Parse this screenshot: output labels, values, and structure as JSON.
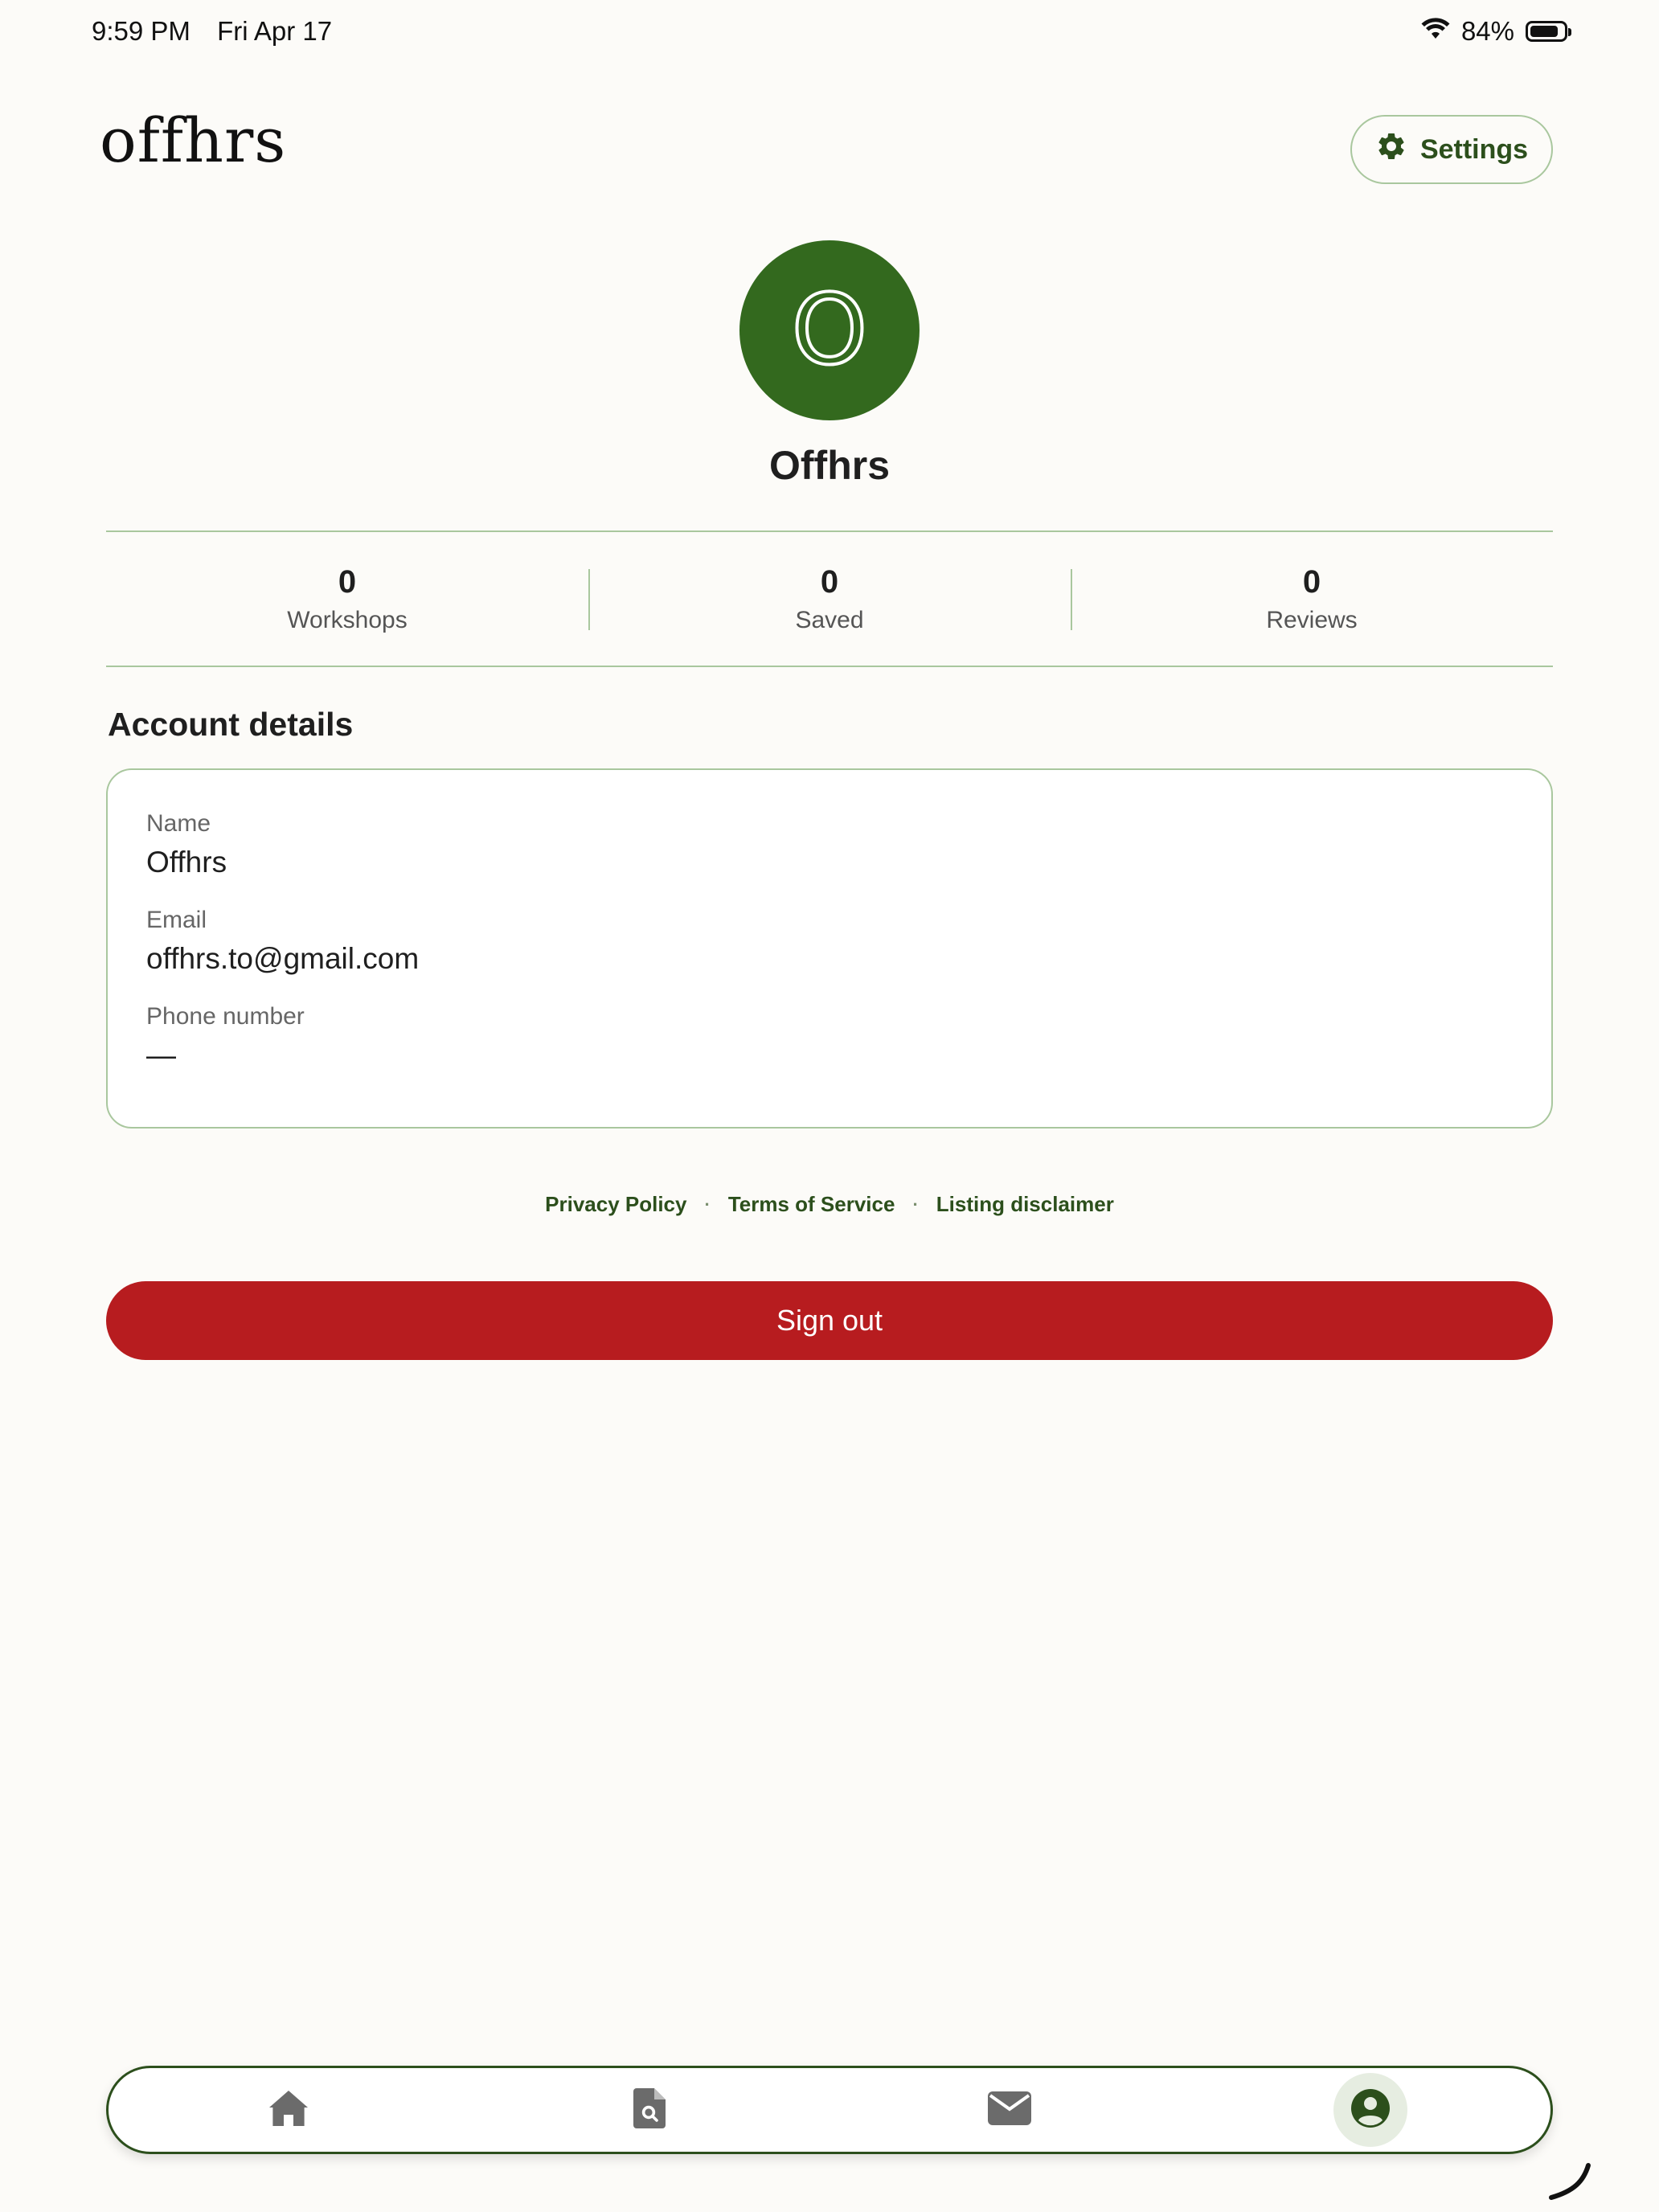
{
  "status_bar": {
    "time": "9:59 PM",
    "date": "Fri Apr 17",
    "battery": "84%",
    "battery_level": 0.84
  },
  "header": {
    "logo": "offhrs",
    "settings_label": "Settings"
  },
  "profile": {
    "initial": "O",
    "name": "Offhrs"
  },
  "stats": [
    {
      "value": "0",
      "label": "Workshops"
    },
    {
      "value": "0",
      "label": "Saved"
    },
    {
      "value": "0",
      "label": "Reviews"
    }
  ],
  "account": {
    "title": "Account details",
    "fields": [
      {
        "label": "Name",
        "value": "Offhrs"
      },
      {
        "label": "Email",
        "value": "offhrs.to@gmail.com"
      },
      {
        "label": "Phone number",
        "value": "—"
      }
    ]
  },
  "footer_links": {
    "privacy": "Privacy Policy",
    "terms": "Terms of Service",
    "disclaimer": "Listing disclaimer",
    "separator": "·"
  },
  "signout_label": "Sign out",
  "tabs": [
    {
      "icon": "home-icon",
      "active": false
    },
    {
      "icon": "document-search-icon",
      "active": false
    },
    {
      "icon": "mail-icon",
      "active": false
    },
    {
      "icon": "user-circle-icon",
      "active": true
    }
  ],
  "colors": {
    "brand_green": "#33691e",
    "accent_green": "#2c4f1c",
    "border_green": "#a9c79e",
    "signout_red": "#b71c1f",
    "background": "#fcfbf8"
  }
}
